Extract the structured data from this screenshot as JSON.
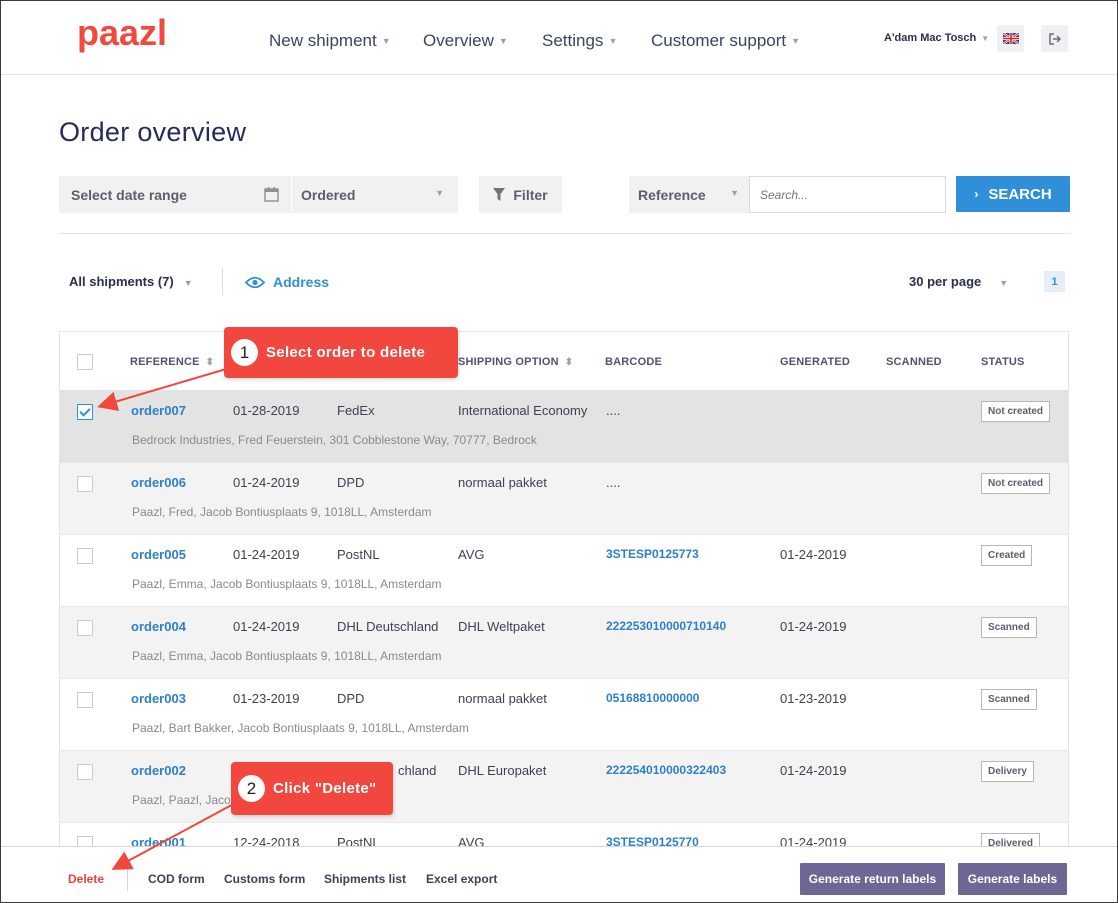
{
  "brand": {
    "logo_text": "paazl",
    "accent": "#f04a3f",
    "primary": "#2f8fd8",
    "button_purple": "#6e6795"
  },
  "nav": {
    "items": [
      {
        "label": "New shipment"
      },
      {
        "label": "Overview"
      },
      {
        "label": "Settings"
      },
      {
        "label": "Customer support"
      }
    ],
    "user": "A'dam Mac Tosch",
    "language_icon": "uk-flag-icon",
    "logout_icon": "logout-icon"
  },
  "page": {
    "title": "Order overview"
  },
  "filters": {
    "date_range": "Select date range",
    "status": "Ordered",
    "filter_label": "Filter",
    "search_field": "Reference",
    "search_placeholder": "Search...",
    "search_button": "SEARCH"
  },
  "toolbar": {
    "all_shipments": "All shipments (7)",
    "address_toggle": "Address",
    "per_page": "30 per page",
    "page": "1"
  },
  "table": {
    "columns": [
      "REFERENCE",
      "",
      "",
      "SHIPPING OPTION",
      "BARCODE",
      "GENERATED",
      "SCANNED",
      "STATUS"
    ],
    "rows": [
      {
        "checked": true,
        "ref": "order007",
        "date": "01-28-2019",
        "carrier": "FedEx",
        "option": "International Economy",
        "barcode": "....",
        "generated": "",
        "scanned": "",
        "status": "Not created",
        "address": "Bedrock Industries, Fred Feuerstein, 301 Cobblestone Way, 70777, Bedrock"
      },
      {
        "checked": false,
        "ref": "order006",
        "date": "01-24-2019",
        "carrier": "DPD",
        "option": "normaal pakket",
        "barcode": "....",
        "generated": "",
        "scanned": "",
        "status": "Not created",
        "address": "Paazl, Fred, Jacob Bontiusplaats 9, 1018LL, Amsterdam"
      },
      {
        "checked": false,
        "ref": "order005",
        "date": "01-24-2019",
        "carrier": "PostNL",
        "option": "AVG",
        "barcode": "3STESP0125773",
        "generated": "01-24-2019",
        "scanned": "",
        "status": "Created",
        "address": "Paazl, Emma, Jacob Bontiusplaats 9, 1018LL, Amsterdam"
      },
      {
        "checked": false,
        "ref": "order004",
        "date": "01-24-2019",
        "carrier": "DHL Deutschland",
        "option": "DHL Weltpaket",
        "barcode": "222253010000710140",
        "generated": "01-24-2019",
        "scanned": "",
        "status": "Scanned",
        "address": "Paazl, Emma, Jacob Bontiusplaats 9, 1018LL, Amsterdam"
      },
      {
        "checked": false,
        "ref": "order003",
        "date": "01-23-2019",
        "carrier": "DPD",
        "option": "normaal pakket",
        "barcode": "05168810000000",
        "generated": "01-23-2019",
        "scanned": "",
        "status": "Scanned",
        "address": "Paazl, Bart Bakker, Jacob Bontiusplaats 9, 1018LL, Amsterdam"
      },
      {
        "checked": false,
        "ref": "order002",
        "date": "",
        "carrier": "chland",
        "option": "DHL Europaket",
        "barcode": "222254010000322403",
        "generated": "01-24-2019",
        "scanned": "",
        "status": "Delivery",
        "address": "Paazl, Paazl, Jacob"
      },
      {
        "checked": false,
        "ref": "order001",
        "date": "12-24-2018",
        "carrier": "PostNL",
        "option": "AVG",
        "barcode": "3STESP0125770",
        "generated": "01-24-2019",
        "scanned": "",
        "status": "Delivered",
        "address": ""
      }
    ]
  },
  "actions": {
    "delete": "Delete",
    "cod_form": "COD form",
    "customs_form": "Customs form",
    "shipments_list": "Shipments list",
    "excel_export": "Excel export",
    "generate_return_labels": "Generate return labels",
    "generate_labels": "Generate labels"
  },
  "callouts": [
    {
      "number": "1",
      "text": "Select order to delete"
    },
    {
      "number": "2",
      "text": "Click \"Delete\""
    }
  ]
}
